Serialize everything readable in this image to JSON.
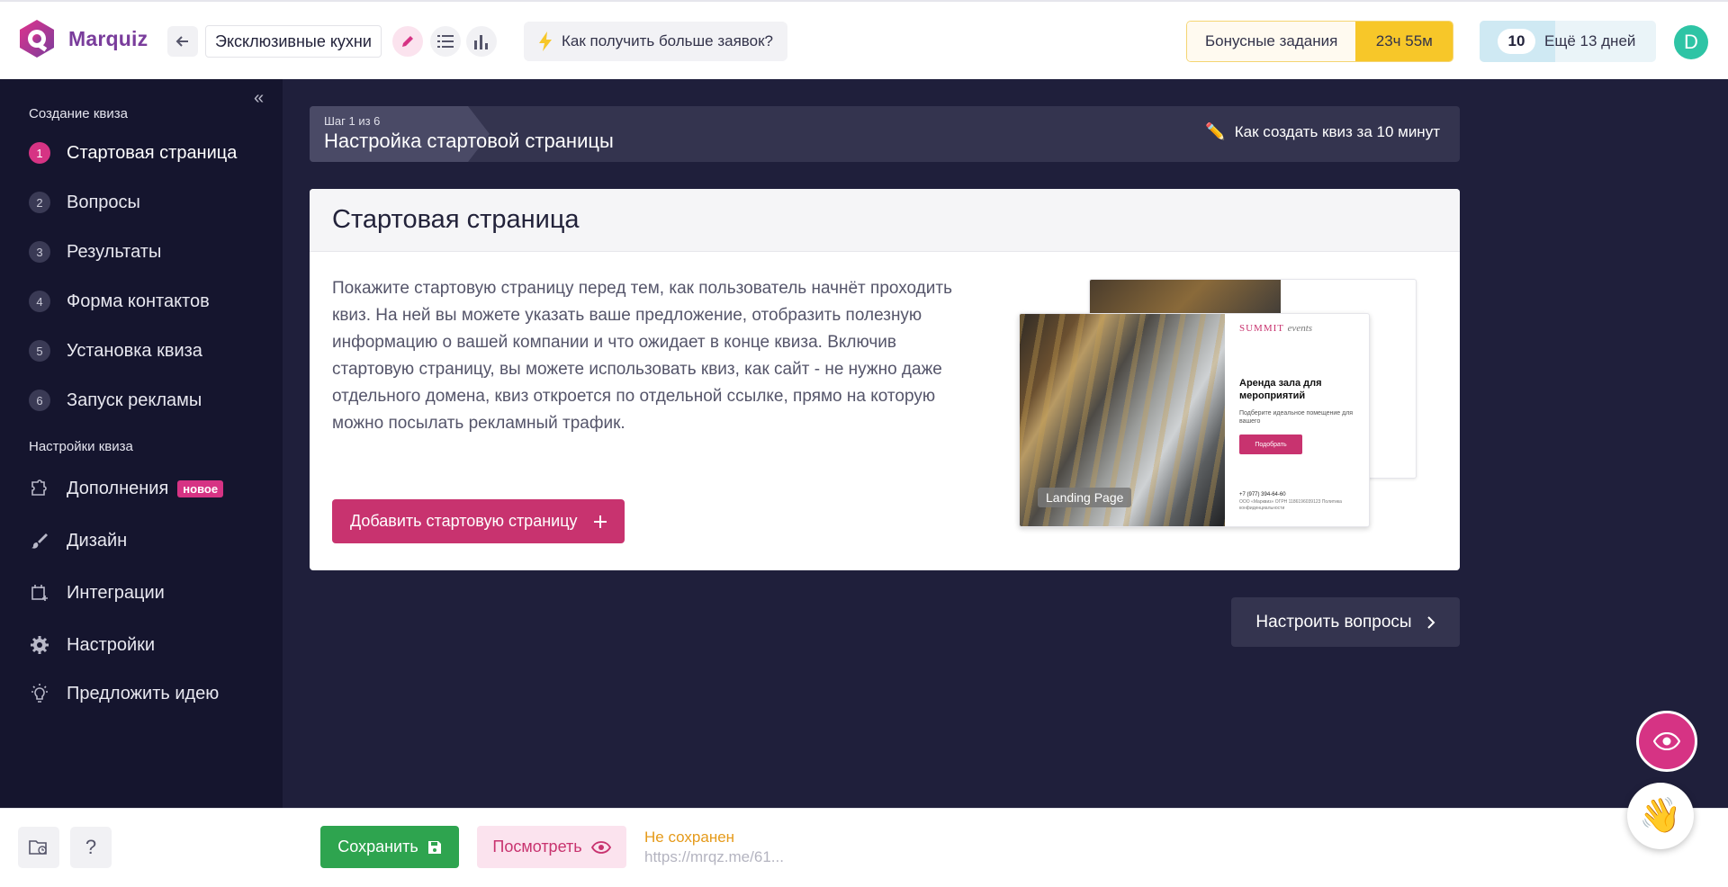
{
  "app": {
    "name": "Marquiz"
  },
  "header": {
    "quiz_name": "Эксклюзивные кухни",
    "tip_label": "Как получить больше заявок?",
    "bonus_label": "Бонусные задания",
    "bonus_timer": "23ч 55м",
    "trial_days_number": "10",
    "trial_days_text": "Ещё 13 дней",
    "trial_progress_fraction": 0.43,
    "avatar_letter": "D"
  },
  "sidebar": {
    "section_create": "Создание квиза",
    "steps": [
      {
        "num": "1",
        "label": "Стартовая страница"
      },
      {
        "num": "2",
        "label": "Вопросы"
      },
      {
        "num": "3",
        "label": "Результаты"
      },
      {
        "num": "4",
        "label": "Форма контактов"
      },
      {
        "num": "5",
        "label": "Установка квиза"
      },
      {
        "num": "6",
        "label": "Запуск рекламы"
      }
    ],
    "section_settings": "Настройки квиза",
    "settings_items": [
      {
        "icon": "puzzle-icon",
        "label": "Дополнения",
        "badge": "новое"
      },
      {
        "icon": "brush-icon",
        "label": "Дизайн"
      },
      {
        "icon": "integrations-icon",
        "label": "Интеграции"
      },
      {
        "icon": "gear-icon",
        "label": "Настройки"
      },
      {
        "icon": "lightbulb-icon",
        "label": "Предложить идею"
      }
    ]
  },
  "step_bar": {
    "step_counter": "Шаг 1 из 6",
    "title": "Настройка стартовой страницы",
    "help_link": "Как создать квиз за 10 минут"
  },
  "card": {
    "title": "Стартовая страница",
    "description": "Покажите стартовую страницу перед тем, как пользователь начнёт проходить квиз. На ней вы можете указать ваше предложение, отобразить полезную информацию о вашей компании и что ожидает в конце квиза. Включив стартовую страницу, вы можете использовать квиз, как сайт - не нужно даже отдельного домена, квиз откроется по отдельной ссылке, прямо на которую можно посылать рекламный трафик.",
    "add_button": "Добавить стартовую страницу",
    "preview": {
      "label": "Landing Page",
      "brand": "SUMMIT",
      "brand_suffix": "events",
      "heading": "Аренда зала для мероприятий",
      "subtext": "Подберите идеальное помещение для вашего",
      "button": "Подобрать",
      "phone": "+7 (977) 394-64-60",
      "address": "ООО «Марквиз» ОГРН 1186196039123 Политика конфиденциальности"
    }
  },
  "next_button": "Настроить вопросы",
  "bottom": {
    "save_button": "Сохранить",
    "view_button": "Посмотреть",
    "status": "Не сохранен",
    "link": "https://mrqz.me/61..."
  },
  "colors": {
    "accent": "#d63384",
    "sidebar_bg": "#15152e",
    "main_bg": "#1f1f3b",
    "save_green": "#2ea44f",
    "bonus_yellow": "#f7c729"
  }
}
